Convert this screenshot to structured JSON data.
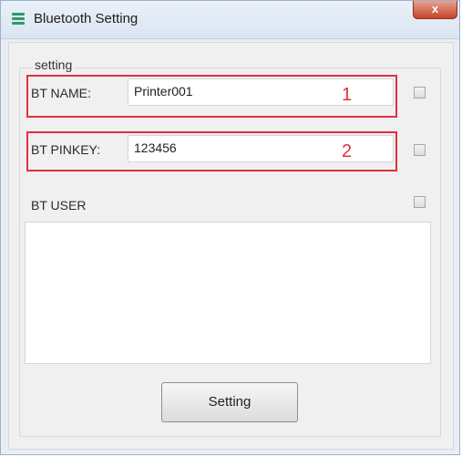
{
  "window": {
    "title": "Bluetooth Setting",
    "close_label": "x"
  },
  "group": {
    "label": "setting"
  },
  "bt_name": {
    "label": "BT NAME:",
    "value": "Printer001",
    "marker": "1",
    "checked": false
  },
  "bt_pinkey": {
    "label": "BT PINKEY:",
    "value": "123456",
    "marker": "2",
    "checked": false
  },
  "bt_user": {
    "label": "BT USER",
    "value": "",
    "checked": false
  },
  "button": {
    "label": "Setting"
  },
  "colors": {
    "highlight": "#e0313c",
    "accent": "#2e9a6a"
  }
}
